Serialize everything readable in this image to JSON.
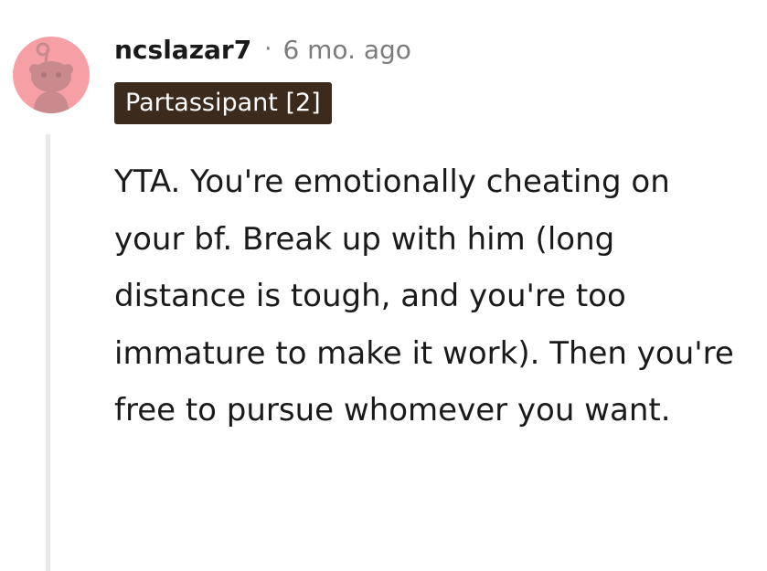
{
  "comment": {
    "username": "ncslazar7",
    "separator": "·",
    "timestamp": "6 mo. ago",
    "flair": "Partassipant [2]",
    "body": "YTA. You're emotionally cheating on your bf. Break up with him (long distance is tough, and you're too immature to make it work). Then you're free to pursue whomever you want.",
    "avatar_icon": "snoo-avatar-icon"
  },
  "colors": {
    "avatar_background": "#f6a0a6",
    "avatar_figure": "#c98a8d",
    "flair_background": "#3c2a1d",
    "flair_text": "#ffffff",
    "username": "#1a1a1b",
    "timestamp": "#7c7c7c",
    "thread_line": "#e9e9ea"
  }
}
